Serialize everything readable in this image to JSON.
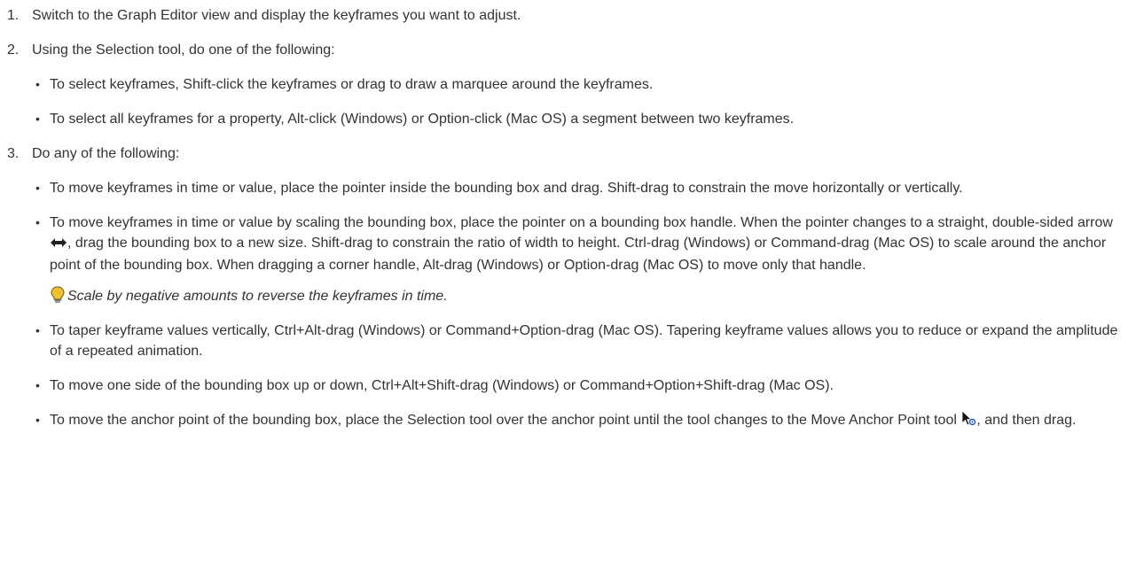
{
  "steps": [
    {
      "number": "1.",
      "text": "Switch to the Graph Editor view and display the keyframes you want to adjust."
    },
    {
      "number": "2.",
      "text": "Using the Selection tool, do one of the following:",
      "bullets": [
        "To select keyframes, Shift-click the keyframes or drag to draw a marquee around the keyframes.",
        "To select all keyframes for a property, Alt-click (Windows) or Option-click (Mac OS) a segment between two keyframes."
      ]
    },
    {
      "number": "3.",
      "text": "Do any of the following:",
      "bullets": {
        "move": "To move keyframes in time or value, place the pointer inside the bounding box and drag. Shift-drag to constrain the move horizontally or vertically.",
        "scale_before_icon": "To move keyframes in time or value by scaling the bounding box, place the pointer on a bounding box handle. When the pointer changes to a straight, double-sided arrow ",
        "scale_after_icon": ", drag the bounding box to a new size. Shift-drag to constrain the ratio of width to height. Ctrl-drag (Windows) or Command-drag (Mac OS) to scale around the anchor point of the bounding box. When dragging a corner handle, Alt-drag (Windows) or Option-drag (Mac OS) to move only that handle.",
        "tip": "Scale by negative amounts to reverse the keyframes in time.",
        "taper": "To taper keyframe values vertically, Ctrl+Alt-drag (Windows) or Command+Option-drag (Mac OS). Tapering keyframe values allows you to reduce or expand the amplitude of a repeated animation.",
        "side": "To move one side of the bounding box up or down, Ctrl+Alt+Shift-drag (Windows) or Command+Option+Shift-drag (Mac OS).",
        "anchor_before_icon": "To move the anchor point of the bounding box, place the Selection tool over the anchor point until the tool changes to the Move Anchor Point tool ",
        "anchor_after_icon": ", and then drag."
      }
    }
  ],
  "icons": {
    "tip": "lightbulb-icon",
    "double_arrow": "double-sided-arrow-icon",
    "move_anchor": "move-anchor-point-icon"
  },
  "colors": {
    "text": "#333333",
    "tip_bulb": "#f2c12e"
  }
}
